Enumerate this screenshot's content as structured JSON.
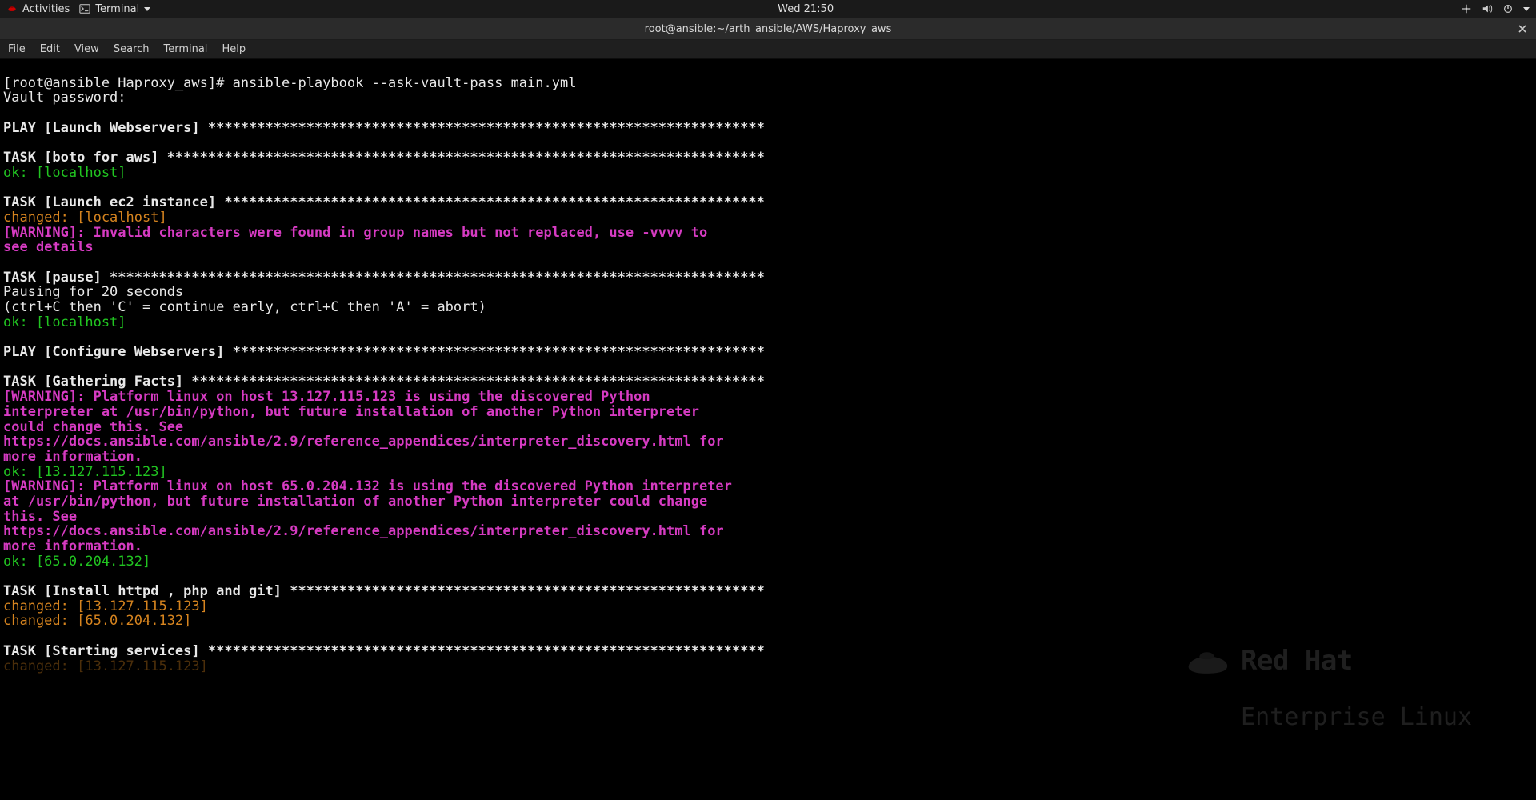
{
  "topbar": {
    "activities": "Activities",
    "terminal_menu": "Terminal",
    "clock": "Wed 21:50"
  },
  "titlebar": {
    "title": "root@ansible:~/arth_ansible/AWS/Haproxy_aws"
  },
  "menubar": {
    "file": "File",
    "edit": "Edit",
    "view": "View",
    "search": "Search",
    "terminal": "Terminal",
    "help": "Help"
  },
  "term": {
    "prompt": "[root@ansible Haproxy_aws]# ",
    "cmd": "ansible-playbook --ask-vault-pass main.yml",
    "vault": "Vault password: ",
    "play1": "PLAY [Launch Webservers] ********************************************************************",
    "task_boto": "TASK [boto for aws] *************************************************************************",
    "ok_local": "ok: [localhost]",
    "task_launch": "TASK [Launch ec2 instance] ******************************************************************",
    "changed_local": "changed: [localhost]",
    "warn_group_1": "[WARNING]: Invalid characters were found in group names but not replaced, use -vvvv to",
    "warn_group_2": "see details",
    "task_pause": "TASK [pause] ********************************************************************************",
    "pause_1": "Pausing for 20 seconds",
    "pause_2": "(ctrl+C then 'C' = continue early, ctrl+C then 'A' = abort)",
    "play2": "PLAY [Configure Webservers] *****************************************************************",
    "task_gather": "TASK [Gathering Facts] **********************************************************************",
    "warn_p1_1": "[WARNING]: Platform linux on host 13.127.115.123 is using the discovered Python",
    "warn_p1_2": "interpreter at /usr/bin/python, but future installation of another Python interpreter",
    "warn_p1_3": "could change this. See",
    "warn_p1_4": "https://docs.ansible.com/ansible/2.9/reference_appendices/interpreter_discovery.html for",
    "warn_p1_5": "more information.",
    "ok_ip1": "ok: [13.127.115.123]",
    "warn_p2_1": "[WARNING]: Platform linux on host 65.0.204.132 is using the discovered Python interpreter",
    "warn_p2_2": "at /usr/bin/python, but future installation of another Python interpreter could change",
    "warn_p2_3": "this. See",
    "warn_p2_4": "https://docs.ansible.com/ansible/2.9/reference_appendices/interpreter_discovery.html for",
    "warn_p2_5": "more information.",
    "ok_ip2": "ok: [65.0.204.132]",
    "task_httpd": "TASK [Install httpd , php and git] **********************************************************",
    "changed_ip1": "changed: [13.127.115.123]",
    "changed_ip2": "changed: [65.0.204.132]",
    "task_start": "TASK [Starting services] ********************************************************************",
    "partial_changed": "changed: [13.127.115.123]"
  },
  "watermark": {
    "line1": "Red Hat",
    "line2": "Enterprise Linux"
  }
}
